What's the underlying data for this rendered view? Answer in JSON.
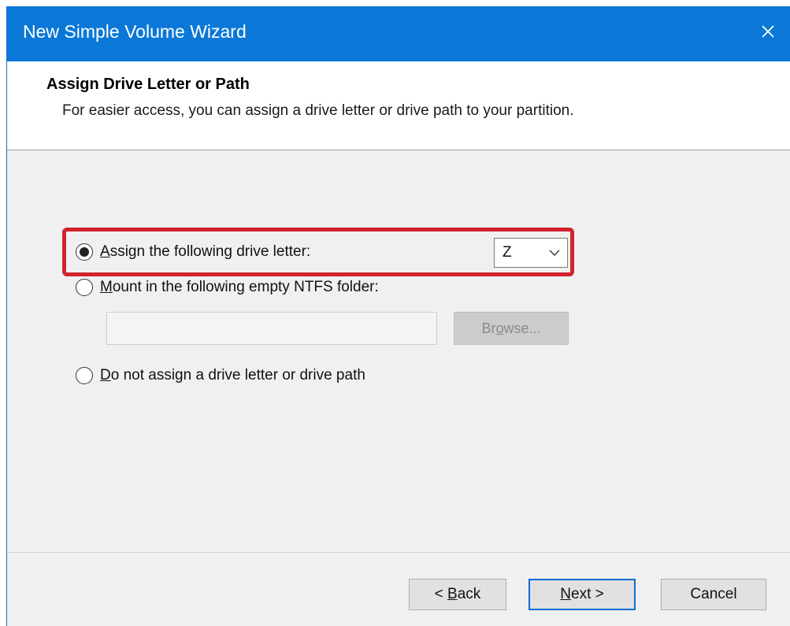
{
  "window": {
    "title": "New Simple Volume Wizard"
  },
  "header": {
    "title": "Assign Drive Letter or Path",
    "subtitle": "For easier access, you can assign a drive letter or drive path to your partition."
  },
  "options": {
    "assign_letter": {
      "prefix": "A",
      "rest": "ssign the following drive letter:",
      "selected": true
    },
    "mount_folder": {
      "prefix": "M",
      "rest": "ount in the following empty NTFS folder:",
      "selected": false
    },
    "no_assign": {
      "prefix": "D",
      "rest": "o not assign a drive letter or drive path",
      "selected": false
    }
  },
  "drive_letter": {
    "value": "Z"
  },
  "folder_path": {
    "value": ""
  },
  "browse": {
    "prefix": "Br",
    "accel": "o",
    "rest": "wse..."
  },
  "footer": {
    "back_prefix": "< ",
    "back_accel": "B",
    "back_rest": "ack",
    "next_accel": "N",
    "next_rest": "ext >",
    "cancel_label": "Cancel"
  },
  "colors": {
    "titlebar": "#0b78d7",
    "highlight": "#d2232e",
    "primary_border": "#0a6dd1"
  },
  "icons": {
    "close": "close-icon",
    "dropdown": "chevron-down-icon"
  }
}
